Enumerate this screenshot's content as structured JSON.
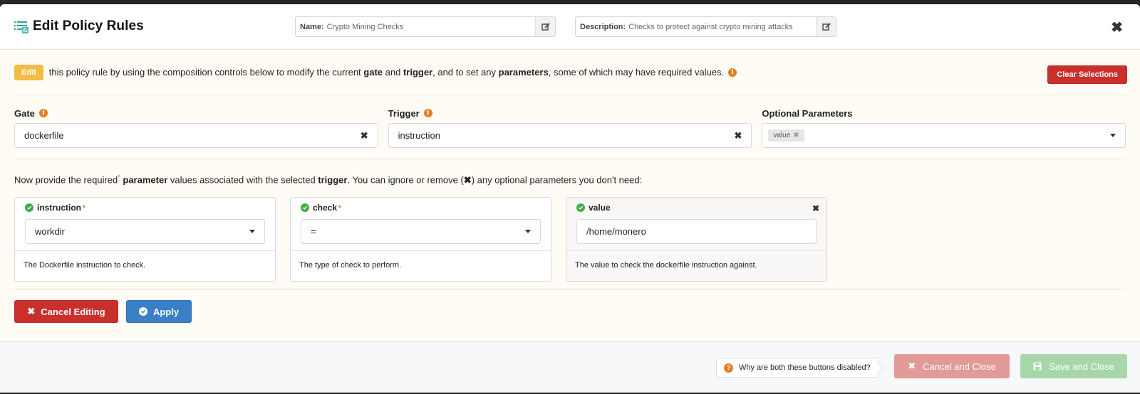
{
  "header": {
    "title": "Edit Policy Rules",
    "name_label": "Name:",
    "name_value": "Crypto Mining Checks",
    "description_label": "Description:",
    "description_value": "Checks to protect against crypto mining attacks",
    "close_glyph": "✖"
  },
  "intro": {
    "edit_badge": "Edit",
    "text_1": "this policy rule by using the composition controls below to modify the current ",
    "bold_gate": "gate",
    "text_2": " and ",
    "bold_trigger": "trigger",
    "text_3": ", and to set any ",
    "bold_parameters": "parameters",
    "text_4": ", some of which may have required values.",
    "clear_button": "Clear Selections"
  },
  "selectors": {
    "gate": {
      "label": "Gate",
      "value": "dockerfile"
    },
    "trigger": {
      "label": "Trigger",
      "value": "instruction"
    },
    "optional": {
      "label": "Optional Parameters",
      "tags": [
        "value"
      ]
    }
  },
  "required_text": {
    "t1": "Now provide the required",
    "star": "*",
    "bold_parameter": "parameter",
    "t2": " values associated with the selected ",
    "bold_trigger": "trigger",
    "t3": ". You can ignore or remove (",
    "x_glyph": "✖",
    "t4": ") any optional parameters you don't need:"
  },
  "params": [
    {
      "name": "instruction",
      "required": true,
      "value": "workdir",
      "type": "select",
      "description": "The Dockerfile instruction to check."
    },
    {
      "name": "check",
      "required": true,
      "value": "=",
      "type": "select",
      "description": "The type of check to perform."
    },
    {
      "name": "value",
      "required": false,
      "value": "/home/monero",
      "type": "text",
      "description": "The value to check the dockerfile instruction against."
    }
  ],
  "actions": {
    "cancel_editing": "Cancel Editing",
    "apply": "Apply"
  },
  "footer": {
    "why_text": "Why are both these buttons disabled?",
    "cancel_close": "Cancel and Close",
    "save_close": "Save and Close"
  },
  "colors": {
    "accent_teal": "#26a69a",
    "danger": "#c9302c",
    "primary": "#3a80c6",
    "warning": "#f2bd42",
    "info_orange": "#e67e22",
    "success": "#3fae49"
  }
}
